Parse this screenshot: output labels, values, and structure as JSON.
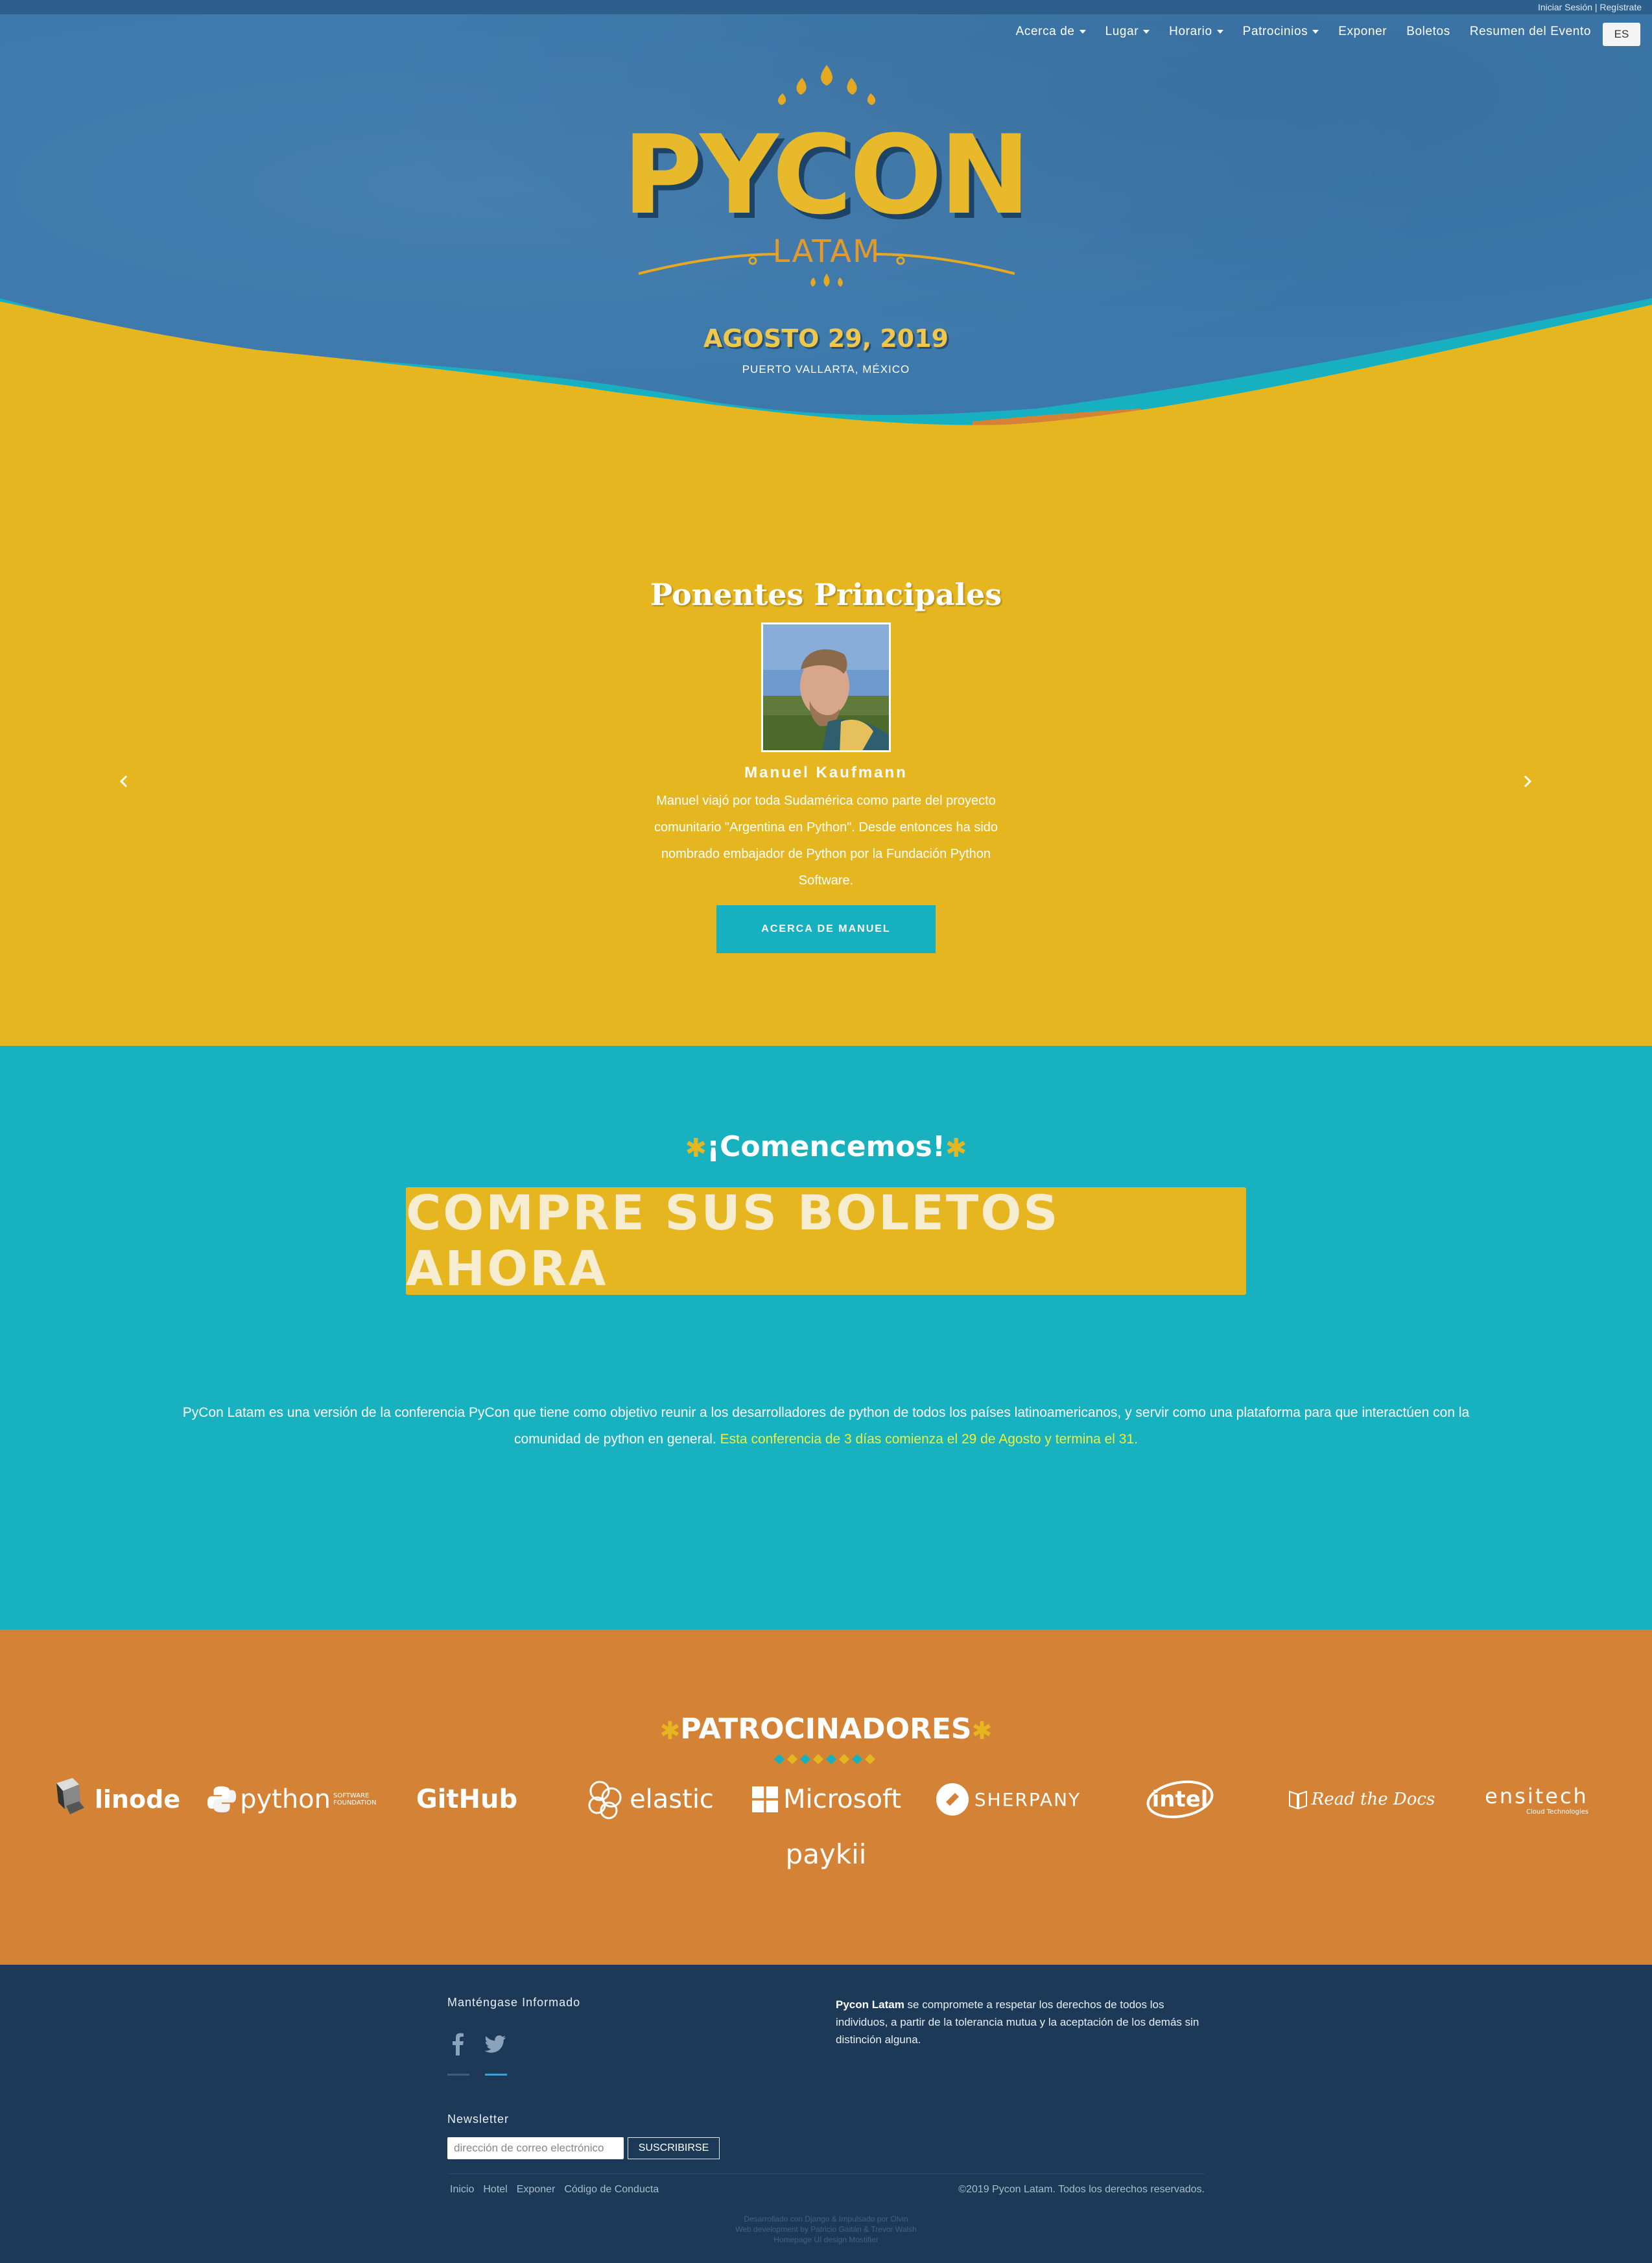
{
  "header": {
    "auth_login": "Iniciar Sesión",
    "auth_separator": " | ",
    "auth_register": "Regístrate",
    "nav": [
      {
        "label": "Acerca de",
        "dropdown": true
      },
      {
        "label": "Lugar",
        "dropdown": true
      },
      {
        "label": "Horario",
        "dropdown": true
      },
      {
        "label": "Patrocinios",
        "dropdown": true
      },
      {
        "label": "Exponer",
        "dropdown": false
      },
      {
        "label": "Boletos",
        "dropdown": false
      },
      {
        "label": "Resumen del Evento",
        "dropdown": false
      }
    ],
    "language": "ES"
  },
  "hero": {
    "logo_title": "PYCON",
    "logo_subtitle": "LATAM",
    "date": "AGOSTO 29, 2019",
    "place": "PUERTO VALLARTA, MÉXICO"
  },
  "speakers": {
    "title": "Ponentes Principales",
    "name": "Manuel Kaufmann",
    "bio": "Manuel viajó por toda Sudamérica como parte del proyecto comunitario \"Argentina en Python\". Desde entonces ha sido nombrado embajador de Python por la Fundación Python Software.",
    "button": "ACERCA DE MANUEL"
  },
  "tickets": {
    "title": "¡Comencemos!",
    "button": "COMPRE SUS BOLETOS AHORA",
    "about_text": "PyCon Latam es una versión de la conferencia PyCon que tiene como objetivo reunir a los desarrolladores de python de todos los países latinoamericanos, y servir como una plataforma para que interactúen con la comunidad de python en general.",
    "about_highlight": "Esta conferencia de 3 días comienza el 29 de Agosto y termina el 31."
  },
  "sponsors": {
    "title": "PATROCINADORES",
    "items": [
      {
        "name": "linode",
        "sub": ""
      },
      {
        "name": "python",
        "sub": "SOFTWARE FOUNDATION"
      },
      {
        "name": "GitHub",
        "sub": ""
      },
      {
        "name": "elastic",
        "sub": ""
      },
      {
        "name": "Microsoft",
        "sub": ""
      },
      {
        "name": "SHERPANY",
        "sub": ""
      },
      {
        "name": "intel",
        "sub": ""
      },
      {
        "name": "Read the Docs",
        "sub": ""
      },
      {
        "name": "ensitech",
        "sub": "Cloud Technologies"
      },
      {
        "name": "paykii",
        "sub": ""
      }
    ]
  },
  "footer": {
    "stay_title": "Manténgase Informado",
    "newsletter_title": "Newsletter",
    "newsletter_placeholder": "dirección de correo electrónico",
    "subscribe_button": "SUSCRIBIRSE",
    "commit_brand": "Pycon Latam",
    "commit_text": " se compromete a respetar los derechos de todos los individuos, a partir de la tolerancia mutua y la aceptación de los demás sin distinción alguna.",
    "links": [
      "Inicio",
      "Hotel",
      "Exponer",
      "Código de Conducta"
    ],
    "copyright": "©2019 Pycon Latam. Todos los derechos reservados.",
    "credits": [
      "Desarrollado con Django & Impulsado por Olvin",
      "Web development by Patricio Gaitán & Trevor Walsh",
      "Homepage UI design Mostifier"
    ]
  },
  "colors": {
    "hero_blue": "#3c78ab",
    "yellow": "#e6b620",
    "teal": "#17b1bf",
    "orange": "#d48236",
    "navy": "#1c3a57",
    "highlight": "#f0ef3c"
  },
  "icons": [
    "chevron-left-icon",
    "chevron-right-icon",
    "facebook-icon",
    "twitter-icon",
    "star-icon"
  ]
}
